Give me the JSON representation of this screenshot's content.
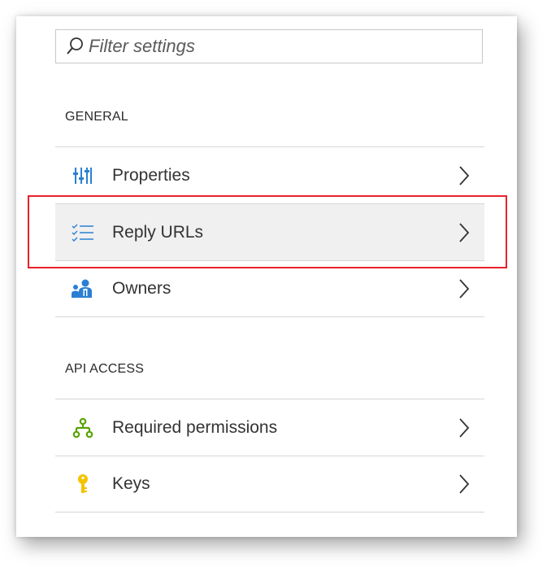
{
  "filter": {
    "placeholder": "Filter settings",
    "icon": "search-icon"
  },
  "sections": {
    "general": {
      "title": "GENERAL",
      "items": [
        {
          "label": "Properties",
          "icon": "properties-sliders-icon"
        },
        {
          "label": "Reply URLs",
          "icon": "checklist-icon"
        },
        {
          "label": "Owners",
          "icon": "owners-icon"
        }
      ]
    },
    "api_access": {
      "title": "API ACCESS",
      "items": [
        {
          "label": "Required permissions",
          "icon": "permissions-hierarchy-icon"
        },
        {
          "label": "Keys",
          "icon": "key-icon"
        }
      ]
    }
  },
  "colors": {
    "highlight": "#e8212b",
    "icon_blue": "#2a7fd4",
    "icon_green": "#57a300",
    "icon_yellow": "#f4c300",
    "selected_row": "#f0f0f0"
  }
}
